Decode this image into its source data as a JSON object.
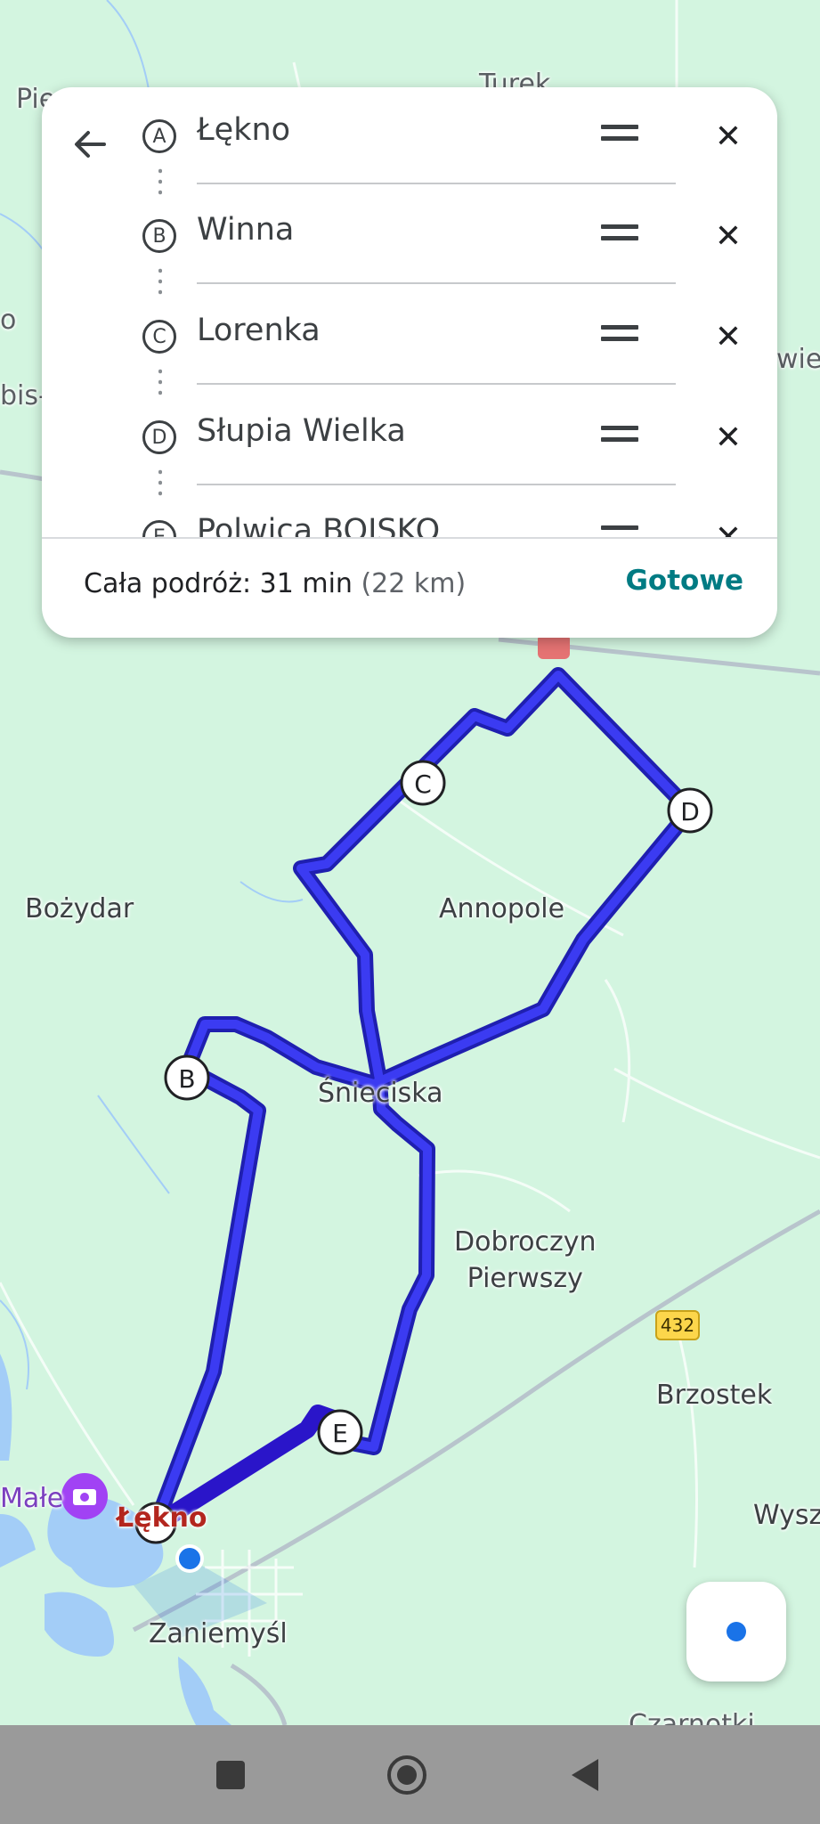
{
  "colors": {
    "route": "#3b3bf2",
    "route_dark": "#1f1fb0",
    "water": "#a3cdf7",
    "map_bg": "#d3f5e0",
    "accent": "#007b83"
  },
  "panel": {
    "back_icon": "arrow-left-icon",
    "stops": [
      {
        "letter": "A",
        "name": "Łękno"
      },
      {
        "letter": "B",
        "name": "Winna"
      },
      {
        "letter": "C",
        "name": "Lorenka"
      },
      {
        "letter": "D",
        "name": "Słupia Wielka"
      },
      {
        "letter": "E",
        "name": "Polwica BOISKO"
      }
    ],
    "summary_label": "Cała podróż: 31 min",
    "summary_distance": "(22 km)",
    "done_label": "Gotowe"
  },
  "map": {
    "labels": {
      "turek": "Turek",
      "pie": "Pie",
      "o": "o",
      "bis": "bis-",
      "wie": "wie",
      "bozydar": "Bożydar",
      "annopole": "Annopole",
      "snieciska": "Śnieciska",
      "dobroczyn": "Dobroczyn\nPierwszy",
      "brzostek": "Brzostek",
      "wysz": "Wysz",
      "male": "Małe",
      "lekno": "Łękno",
      "zaniemysl": "Zaniemyśl",
      "czarnotki": "Czarnotki"
    },
    "road_shield": "432",
    "markers": {
      "b": "B",
      "c": "C",
      "d": "D",
      "e": "E"
    }
  },
  "navbar": {
    "recents_icon": "square-icon",
    "home_icon": "circle-icon",
    "back_icon": "triangle-back-icon"
  }
}
